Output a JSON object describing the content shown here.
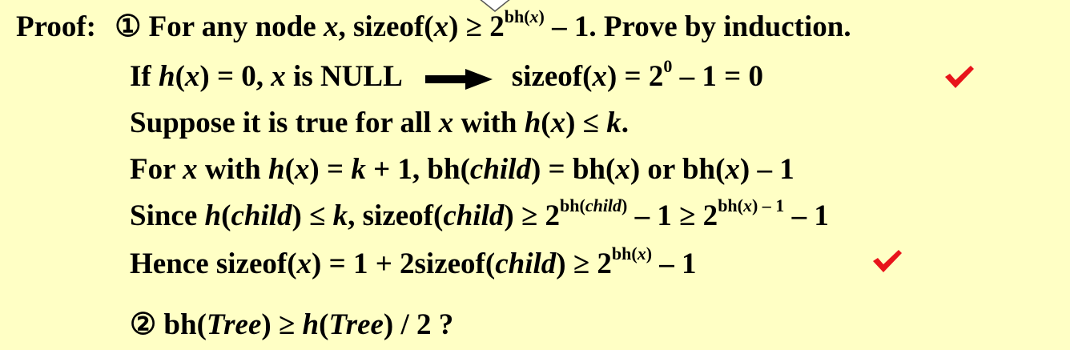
{
  "colors": {
    "background": "#FFFFC5",
    "text": "#000000",
    "check": "#E8141B"
  },
  "lines": {
    "l1": {
      "proof": "Proof:",
      "circ": "①",
      "t1": " For any node ",
      "x": "x",
      "t2": ", sizeof(",
      "x2": "x",
      "t3": ") ≥ 2",
      "sup_bh": "bh(",
      "sup_x": "x",
      "sup_close": ")",
      "t4": " – 1.  Prove by induction."
    },
    "l2": {
      "t1": "If ",
      "h": "h",
      "t2": "(",
      "x": "x",
      "t3": ") = 0, ",
      "x2": "x",
      "t4": " is NULL",
      "t5": "sizeof(",
      "x3": "x",
      "t6": ") = 2",
      "sup": "0",
      "t7": " – 1 = 0"
    },
    "l3": {
      "t1": "Suppose it is true for all ",
      "x": "x",
      "t2": " with ",
      "h": "h",
      "t3": "(",
      "x2": "x",
      "t4": ") ≤ ",
      "k": "k",
      "t5": "."
    },
    "l4": {
      "t1": "For ",
      "x": "x",
      "t2": " with ",
      "h": "h",
      "t3": "(",
      "x2": "x",
      "t4": ") = ",
      "k": "k",
      "t5": " + 1, bh(",
      "child": "child",
      "t6": ") =  bh(",
      "x3": "x",
      "t7": ") or bh(",
      "x4": "x",
      "t8": ") – 1"
    },
    "l5": {
      "t1": "Since ",
      "h": "h",
      "t2": "(",
      "child": "child",
      "t3": ") ≤ ",
      "k": "k",
      "t4": ", sizeof(",
      "child2": "child",
      "t5": ") ≥ 2",
      "sup1_a": "bh(",
      "sup1_child": "child",
      "sup1_b": ")",
      "t6": " – 1  ≥ 2",
      "sup2_a": "bh(",
      "sup2_x": "x",
      "sup2_b": ") – 1",
      "t7": " – 1"
    },
    "l6": {
      "t1": "Hence sizeof(",
      "x": "x",
      "t2": ") = 1 + 2sizeof(",
      "child": "child",
      "t3": ") ≥ 2",
      "sup_a": "bh(",
      "sup_x": "x",
      "sup_b": ")",
      "t4": " – 1"
    },
    "l7": {
      "circ": "②",
      "t1": " bh(",
      "tree": "Tree",
      "t2": ") ≥ ",
      "h": "h",
      "t3": "(",
      "tree2": "Tree",
      "t4": ") / 2  ?"
    }
  },
  "icons": {
    "arrow": "right-arrow-icon",
    "check": "check-mark-icon",
    "callout": "callout-pointer-icon"
  }
}
